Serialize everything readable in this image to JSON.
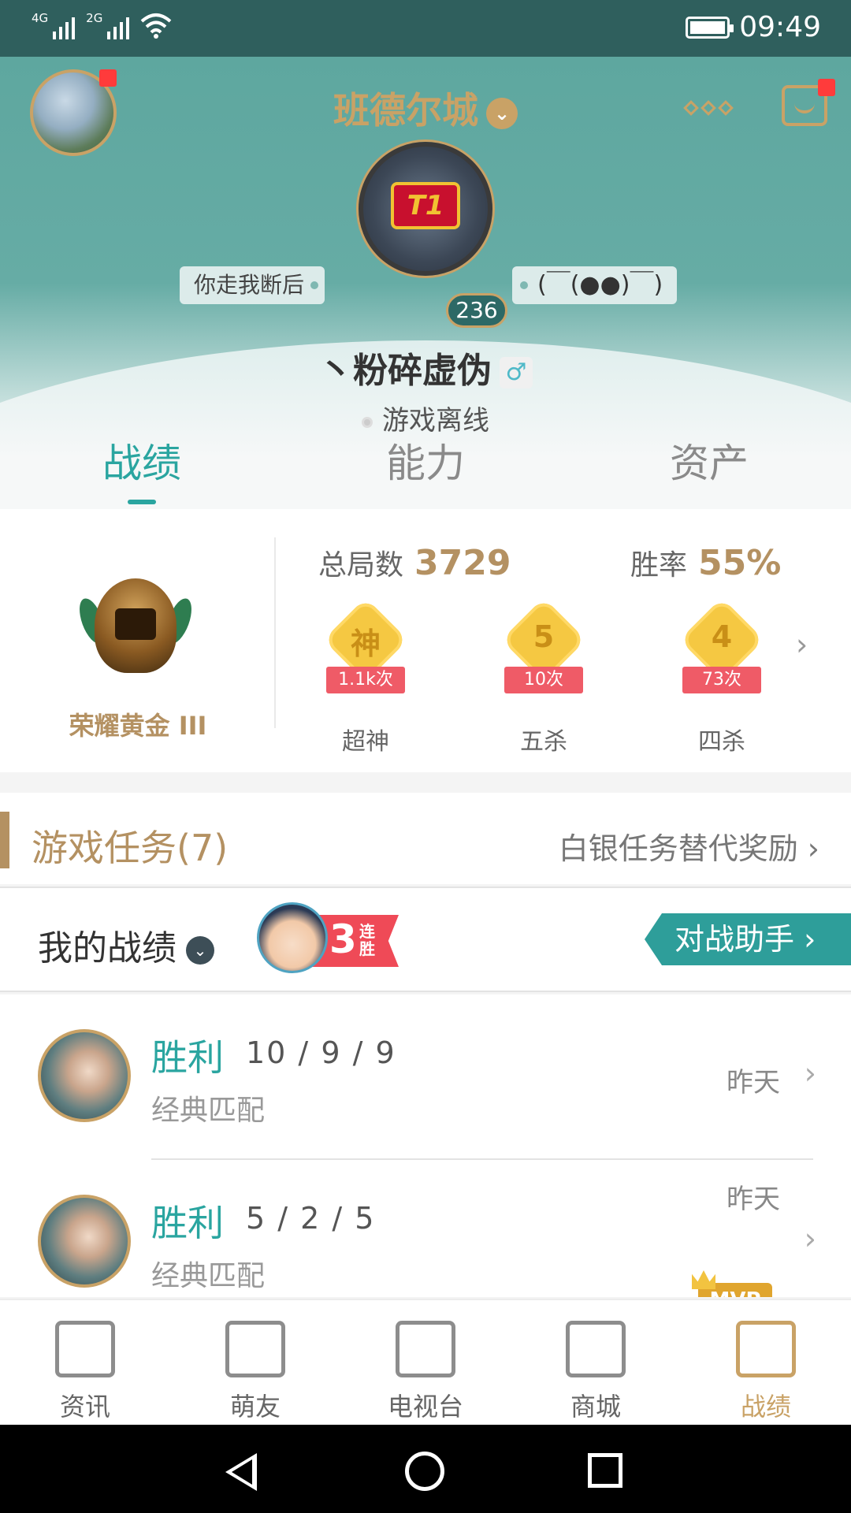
{
  "statusbar": {
    "signal1": "4G",
    "signal2": "2G",
    "time": "09:49"
  },
  "header": {
    "server": "班德尔城",
    "tag_left": "你走我断后",
    "tag_right": "(￣(●●)￣)",
    "level": "236",
    "nickname": "丶粉碎虚伪",
    "gender_symbol": "♂",
    "status": "游戏离线",
    "emblem_text": "T1"
  },
  "tabs": [
    {
      "label": "战绩",
      "active": true
    },
    {
      "label": "能力",
      "active": false
    },
    {
      "label": "资产",
      "active": false
    }
  ],
  "stats": {
    "rank": "荣耀黄金 III",
    "total_label": "总局数",
    "total_value": "3729",
    "winrate_label": "胜率",
    "winrate_value": "55%",
    "badges": [
      {
        "glyph": "神",
        "count": "1.1k次",
        "caption": "超神"
      },
      {
        "glyph": "5",
        "count": "10次",
        "caption": "五杀"
      },
      {
        "glyph": "4",
        "count": "73次",
        "caption": "四杀"
      }
    ]
  },
  "tasks": {
    "title": "游戏任务(7)",
    "right": "白银任务替代奖励"
  },
  "my_record": {
    "label": "我的战绩",
    "streak_num": "3",
    "streak_text": "连胜",
    "assist_button": "对战助手"
  },
  "matches": [
    {
      "result": "胜利",
      "kda": "10 / 9 / 9",
      "mode": "经典匹配",
      "when": "昨天",
      "mvp": false
    },
    {
      "result": "胜利",
      "kda": "5 / 2 / 5",
      "mode": "经典匹配",
      "when": "昨天",
      "mvp": true,
      "mvp_label": "MVP"
    }
  ],
  "bottom_nav": [
    {
      "label": "资讯",
      "icon": "news-icon",
      "active": false
    },
    {
      "label": "萌友",
      "icon": "friends-icon",
      "active": false
    },
    {
      "label": "电视台",
      "icon": "tv-icon",
      "active": false
    },
    {
      "label": "商城",
      "icon": "store-icon",
      "active": false
    },
    {
      "label": "战绩",
      "icon": "record-icon",
      "active": true
    }
  ],
  "colors": {
    "teal": "#2aa5a0",
    "gold": "#c9a266",
    "header": "#5ea79f"
  }
}
